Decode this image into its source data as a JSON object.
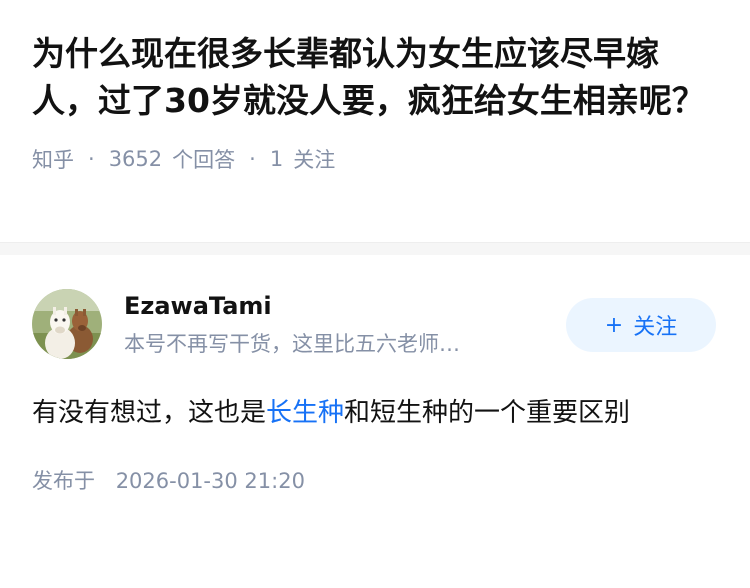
{
  "question": {
    "title": "为什么现在很多长辈都认为女生应该尽早嫁人，过了30岁就没人要，疯狂给女生相亲呢？",
    "source": "知乎",
    "separator": "·",
    "answer_count": "3652",
    "answer_count_label": "个回答",
    "follow_count": "1",
    "follow_count_label": "关注"
  },
  "answer": {
    "author_name": "EzawaTami",
    "author_bio": "本号不再写干货，这里比五六老师…",
    "follow_button": {
      "icon": "plus-icon",
      "plus": "+",
      "label": "关注"
    },
    "text_before": "有没有想过，这也是",
    "text_link": "长生种",
    "text_after": "和短生种的一个重要区别",
    "post_time_label": "发布于",
    "post_time": "2026-01-30 21:20"
  },
  "colors": {
    "link": "#1772f6",
    "meta": "#8590a6",
    "button_bg": "#ebf5ff"
  }
}
